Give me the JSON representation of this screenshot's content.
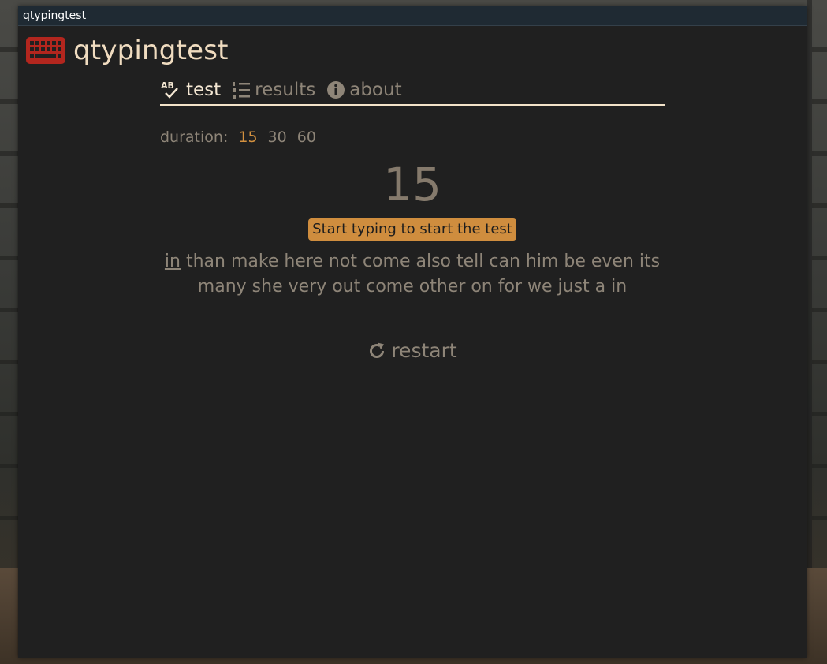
{
  "window": {
    "title": "qtypingtest"
  },
  "app": {
    "name": "qtypingtest",
    "logo_icon": "keyboard-icon",
    "accent_color": "#cf8d3e",
    "logo_color": "#b3261e"
  },
  "tabs": [
    {
      "label": "test",
      "icon": "spellcheck-icon",
      "active": true
    },
    {
      "label": "results",
      "icon": "list-ordered-icon",
      "active": false
    },
    {
      "label": "about",
      "icon": "info-icon",
      "active": false
    }
  ],
  "duration": {
    "label": "duration:",
    "options": [
      "15",
      "30",
      "60"
    ],
    "selected": "15"
  },
  "timer": {
    "value": "15"
  },
  "hint": {
    "text": "Start typing to start the test"
  },
  "words": {
    "current": "in",
    "rest": "than make here not come also tell can him be even its many she very out come other on for we just a in"
  },
  "restart": {
    "label": "restart",
    "icon": "refresh-icon"
  }
}
